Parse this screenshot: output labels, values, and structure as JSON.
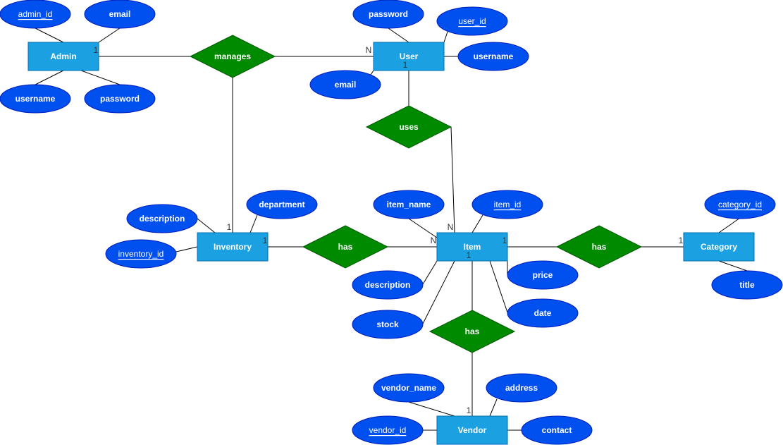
{
  "entities": {
    "admin": "Admin",
    "user": "User",
    "inventory": "Inventory",
    "item": "Item",
    "category": "Category",
    "vendor": "Vendor"
  },
  "relationships": {
    "manages": "manages",
    "uses": "uses",
    "inventory_item_has": "has",
    "item_category_has": "has",
    "item_vendor_has": "has"
  },
  "attributes": {
    "admin_id": {
      "label": "admin_id",
      "key": true
    },
    "admin_email": {
      "label": "email",
      "key": false
    },
    "admin_username": {
      "label": "username",
      "key": false
    },
    "admin_password": {
      "label": "password",
      "key": false
    },
    "user_password": {
      "label": "password",
      "key": false
    },
    "user_id": {
      "label": "user_id",
      "key": true
    },
    "user_username": {
      "label": "username",
      "key": false
    },
    "user_email": {
      "label": "email",
      "key": false
    },
    "inventory_description": {
      "label": "description",
      "key": false
    },
    "inventory_department": {
      "label": "department",
      "key": false
    },
    "inventory_id": {
      "label": "inventory_id",
      "key": true
    },
    "item_name": {
      "label": "item_name",
      "key": false
    },
    "item_id": {
      "label": "item_id",
      "key": true
    },
    "item_description": {
      "label": "description",
      "key": false
    },
    "item_stock": {
      "label": "stock",
      "key": false
    },
    "item_price": {
      "label": "price",
      "key": false
    },
    "item_date": {
      "label": "date",
      "key": false
    },
    "category_id": {
      "label": "category_id",
      "key": true
    },
    "category_title": {
      "label": "title",
      "key": false
    },
    "vendor_name": {
      "label": "vendor_name",
      "key": false
    },
    "vendor_address": {
      "label": "address",
      "key": false
    },
    "vendor_id": {
      "label": "vendor_id",
      "key": true
    },
    "vendor_contact": {
      "label": "contact",
      "key": false
    }
  },
  "cardinalities": {
    "admin_manages": "1",
    "user_manages": "N",
    "user_uses": "1",
    "item_uses": "N",
    "inventory_manages": "1",
    "inventory_has": "1",
    "item_inventory_has": "N",
    "item_category_has": "1",
    "category_has": "1",
    "item_vendor_has": "1",
    "vendor_has": "1"
  }
}
